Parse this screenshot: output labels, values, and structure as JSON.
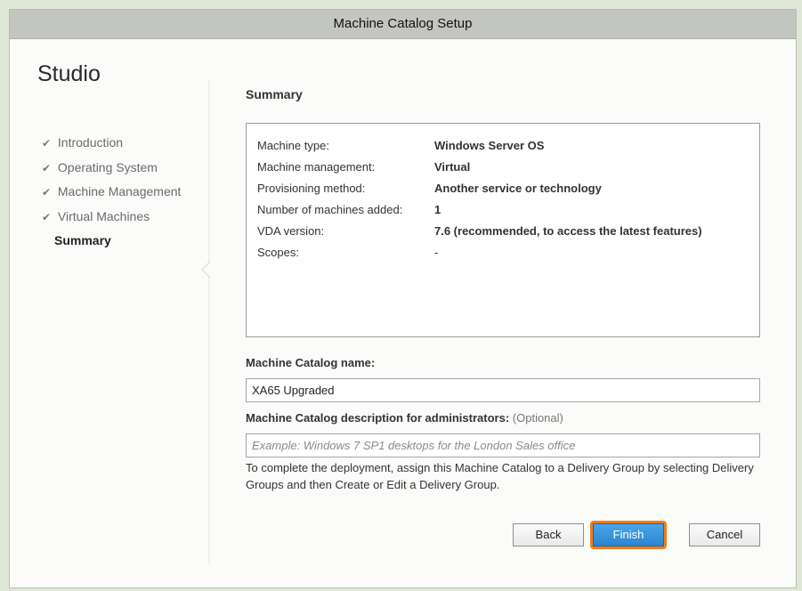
{
  "window": {
    "title": "Machine Catalog Setup"
  },
  "sidebar": {
    "brand": "Studio",
    "steps": [
      {
        "label": "Introduction",
        "done": true
      },
      {
        "label": "Operating System",
        "done": true
      },
      {
        "label": "Machine Management",
        "done": true
      },
      {
        "label": "Virtual Machines",
        "done": true
      },
      {
        "label": "Summary",
        "done": false,
        "current": true
      }
    ],
    "check_glyph": "✔"
  },
  "main": {
    "heading": "Summary",
    "summary": [
      {
        "label": "Machine type:",
        "value": "Windows Server OS"
      },
      {
        "label": "Machine management:",
        "value": "Virtual"
      },
      {
        "label": "Provisioning method:",
        "value": "Another service or technology"
      },
      {
        "label": "Number of machines added:",
        "value": "1"
      },
      {
        "label": "VDA version:",
        "value": "7.6 (recommended, to access the latest features)"
      },
      {
        "label": "Scopes:",
        "value": "-"
      }
    ],
    "catalog_name_label": "Machine Catalog name:",
    "catalog_name_value": "XA65 Upgraded",
    "description_label": "Machine Catalog description for administrators:",
    "description_optional": "(Optional)",
    "description_placeholder": "Example: Windows 7 SP1 desktops for the London Sales office",
    "note": "To complete the deployment, assign this Machine Catalog to a Delivery Group by selecting Delivery Groups and then Create or Edit a Delivery Group."
  },
  "buttons": {
    "back": "Back",
    "finish": "Finish",
    "cancel": "Cancel"
  },
  "colors": {
    "highlight": "#f07d17",
    "primary": "#2c85d2",
    "window_bg": "#fbfcfa",
    "titlebar": "#c3c5c1"
  }
}
